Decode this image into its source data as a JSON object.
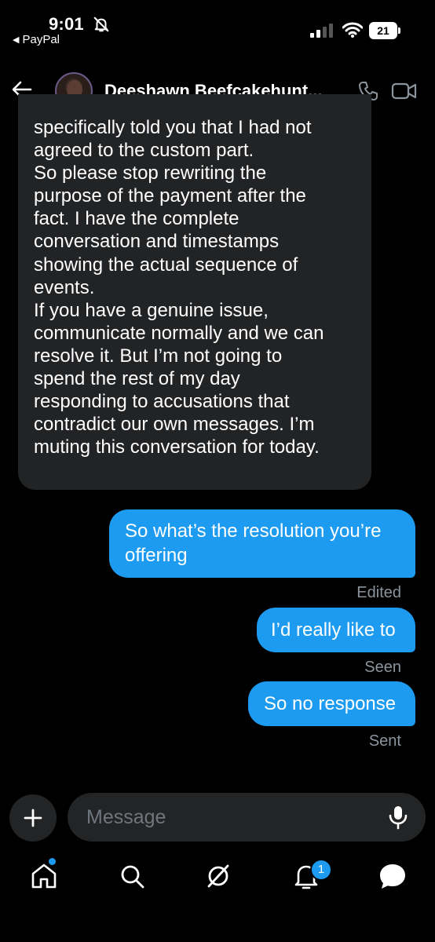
{
  "status_bar": {
    "time": "9:01",
    "back_app": "PayPal",
    "battery": "21"
  },
  "header": {
    "contact_name": "Deeshawn Beefcakehunt..."
  },
  "messages": {
    "incoming": {
      "lines": [
        "specifically told you that I had not",
        "agreed to the custom part.",
        "So please stop rewriting the",
        "purpose of the payment after the",
        "fact. I have the complete",
        "conversation and timestamps",
        "showing the actual sequence of",
        "events.",
        "If you have a genuine issue,",
        "communicate normally and we can",
        "resolve it. But I’m not going to",
        "spend the rest of my day",
        "responding to accusations that",
        "contradict our own messages. I’m",
        "muting this conversation for today."
      ]
    },
    "outgoing": [
      {
        "lines": [
          "So what’s the resolution you’re",
          "offering"
        ],
        "receipt": "Edited"
      },
      {
        "text": "I’d really like to",
        "receipt": "Seen"
      },
      {
        "text": "So no response",
        "receipt": "Sent"
      }
    ]
  },
  "composer": {
    "placeholder": "Message"
  },
  "nav": {
    "notification_count": "1"
  },
  "colors": {
    "accent": "#1d9bf0",
    "incoming_bubble": "#222325",
    "background": "#000000"
  }
}
